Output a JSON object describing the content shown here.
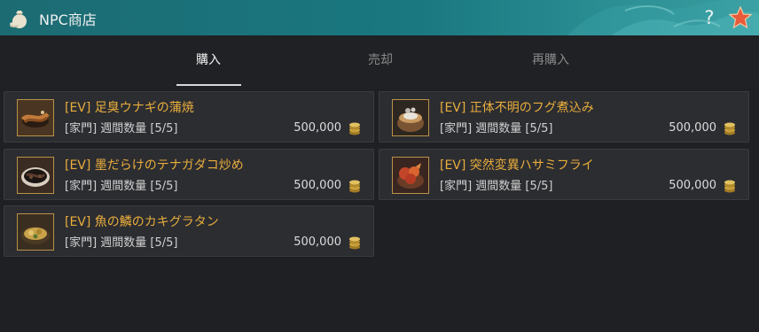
{
  "window": {
    "title": "NPC商店",
    "help_label": "?",
    "colors": {
      "title_bar": "#1a7880",
      "item_name": "#e9ad3c",
      "star": "#e85a3a"
    }
  },
  "tabs": [
    {
      "label": "購入",
      "active": true
    },
    {
      "label": "売却",
      "active": false
    },
    {
      "label": "再購入",
      "active": false
    }
  ],
  "items": [
    {
      "name": "[EV] 足臭ウナギの蒲焼",
      "limit": "[家門] 週間数量 [5/5]",
      "price": "500,000",
      "icon": "grilled-eel-icon"
    },
    {
      "name": "[EV] 正体不明のフグ煮込み",
      "limit": "[家門] 週間数量 [5/5]",
      "price": "500,000",
      "icon": "pufferfish-stew-icon"
    },
    {
      "name": "[EV] 墨だらけのテナガダコ炒め",
      "limit": "[家門] 週間数量 [5/5]",
      "price": "500,000",
      "icon": "octopus-stirfry-icon"
    },
    {
      "name": "[EV] 突然変異ハサミフライ",
      "limit": "[家門] 週間数量 [5/5]",
      "price": "500,000",
      "icon": "fried-claw-icon"
    },
    {
      "name": "[EV] 魚の鱗のカキグラタン",
      "limit": "[家門] 週間数量 [5/5]",
      "price": "500,000",
      "icon": "oyster-gratin-icon"
    }
  ]
}
